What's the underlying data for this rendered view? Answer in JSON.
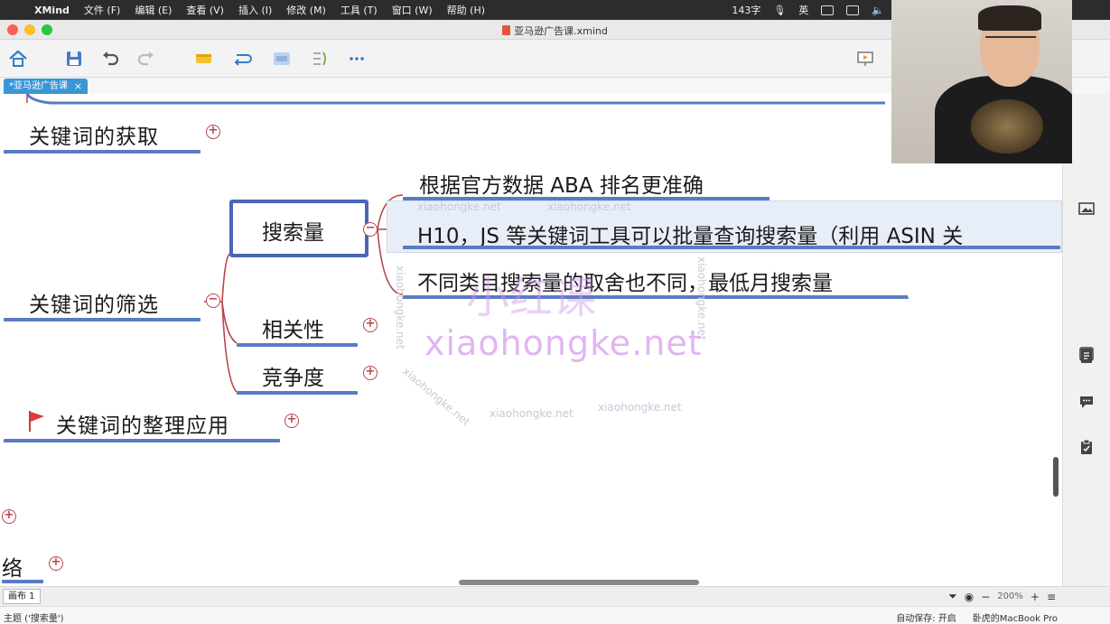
{
  "menubar": {
    "app": "XMind",
    "items": [
      "文件 (F)",
      "编辑 (E)",
      "查看 (V)",
      "插入 (I)",
      "修改 (M)",
      "工具 (T)",
      "窗口 (W)",
      "帮助 (H)"
    ],
    "word_count": "143字",
    "ime": "英"
  },
  "window": {
    "title": "亚马逊广告课.xmind"
  },
  "tab": {
    "label": "*亚马逊广告课",
    "close": "×"
  },
  "mindmap": {
    "topic_acquire": "关键词的获取",
    "topic_filter": "关键词的筛选",
    "topic_organize": "关键词的整理应用",
    "topic_cut": "络",
    "sub_search_volume": "搜索量",
    "sub_relevance": "相关性",
    "sub_competition": "竞争度",
    "leaf_1": "根据官方数据 ABA 排名更准确",
    "leaf_2": "H10，JS 等关键词工具可以批量查询搜索量（利用 ASIN 关",
    "leaf_3": "不同类目搜索量的取舍也不同，最低月搜索量"
  },
  "watermarks": {
    "url": "xiaohongke.net",
    "cn": "小红课",
    "big": "xiaohongke.net"
  },
  "sheetbar": {
    "sheet": "画布 1",
    "zoom": "200%"
  },
  "statusbar": {
    "topic": "主题 ('搜索量')",
    "autosave": "自动保存: 开启",
    "device": "卧虎的MacBook Pro"
  },
  "colors": {
    "branch": "#b9454b",
    "underline": "#5a7bc4",
    "selection": "#4a66b8",
    "accent": "#3a97d6"
  }
}
